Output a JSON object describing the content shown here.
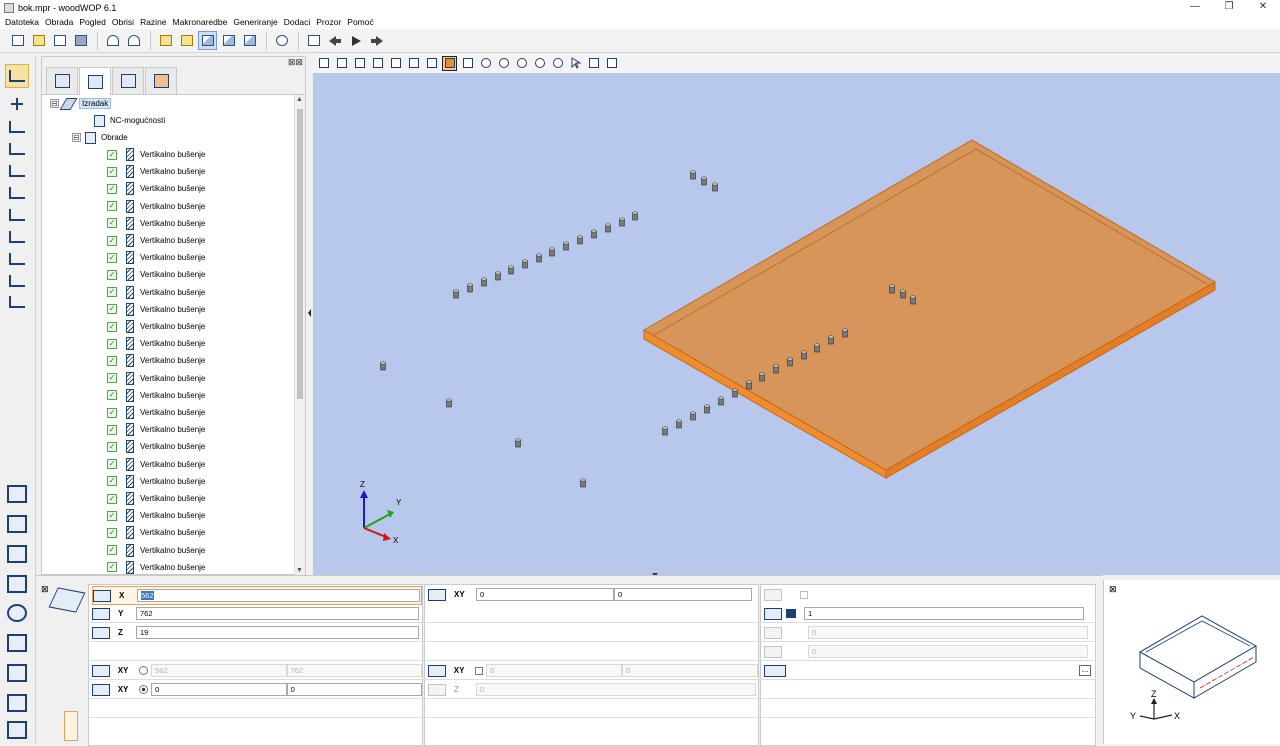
{
  "window": {
    "title": "bok.mpr - woodWOP 6.1",
    "minimize": "—",
    "restore": "❐",
    "close": "✕"
  },
  "menu": [
    "Datoteka",
    "Obrada",
    "Pogled",
    "Obrisi",
    "Razine",
    "Makronaredbe",
    "Generiranje",
    "Dodaci",
    "Prozor",
    "Pomoć"
  ],
  "tree": {
    "root": "Izradak",
    "nc": "NC-mogućnosti",
    "group": "Obrade",
    "items": [
      "Vertikalno bušenje",
      "Vertikalno bušenje",
      "Vertikalno bušenje",
      "Vertikalno bušenje",
      "Vertikalno bušenje",
      "Vertikalno bušenje",
      "Vertikalno bušenje",
      "Vertikalno bušenje",
      "Vertikalno bušenje",
      "Vertikalno bušenje",
      "Vertikalno bušenje",
      "Vertikalno bušenje",
      "Vertikalno bušenje",
      "Vertikalno bušenje",
      "Vertikalno bušenje",
      "Vertikalno bušenje",
      "Vertikalno bušenje",
      "Vertikalno bušenje",
      "Vertikalno bušenje",
      "Vertikalno bušenje",
      "Vertikalno bušenje",
      "Vertikalno bušenje",
      "Vertikalno bušenje",
      "Vertikalno bušenje",
      "Vertikalno bušenje"
    ],
    "expand_minus": "⊟",
    "check": "✓",
    "scroll_up": "▲",
    "scroll_down": "▼",
    "panel_close": "⊠⊠"
  },
  "axes": {
    "x": "X",
    "y": "Y",
    "z": "Z"
  },
  "props": {
    "x_label": "X",
    "x_value": "562",
    "y_label": "Y",
    "y_value": "762",
    "z_label": "Z",
    "z_value": "19",
    "xy_label": "XY",
    "xy_a": "0",
    "xy_b": "0",
    "count_value": "1",
    "dim_value_1": "0",
    "dim_value_2": "0",
    "xy2_label": "XY",
    "xy2_a": "562",
    "xy2_b": "762",
    "xy3_label": "XY",
    "xy3_a": "0",
    "xy3_b": "0",
    "xy4_label": "XY",
    "xy4_a": "0",
    "xy4_b": "0",
    "z2_label": "Z",
    "z2_value": "0",
    "more_button": "...",
    "close": "⊠"
  },
  "preview_axes": {
    "x": "X",
    "y": "Y",
    "z": "Z"
  },
  "colors": {
    "viewport_bg": "#b8c8ec",
    "panel": "#d8955a",
    "panel_edge": "#e07c25",
    "accent": "#1f3e73"
  }
}
